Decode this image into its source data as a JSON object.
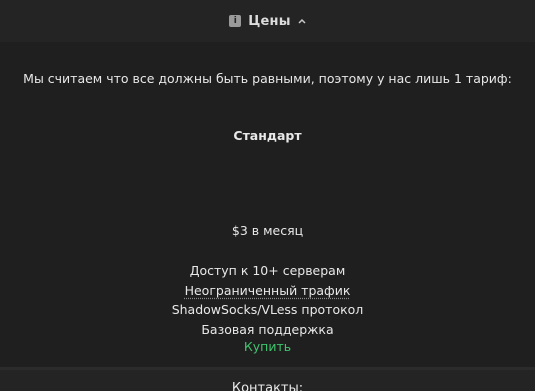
{
  "pricing_section": {
    "title": "Цены",
    "icon": "info-icon",
    "chevron": "chevron-up-icon",
    "intro": "Мы считаем что все должны быть равными, поэтому у нас лишь 1 тариф:",
    "plan": {
      "name": "Стандарт",
      "price": "$3 в месяц",
      "features": [
        "Доступ к 10+ серверам",
        "Неограниченный трафик",
        "ShadowSocks/VLess протокол",
        "Базовая поддержка"
      ],
      "buy_label": "Купить"
    }
  },
  "contacts_section": {
    "title": "Контакты:"
  },
  "colors": {
    "background": "#1f1f1f",
    "header": "#242424",
    "buy_link": "#3ec46d"
  }
}
